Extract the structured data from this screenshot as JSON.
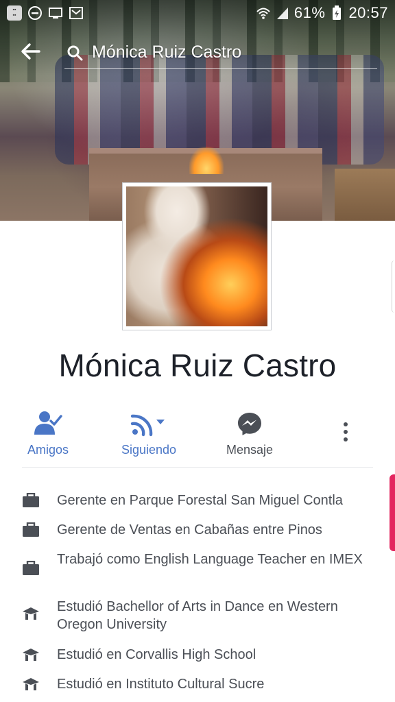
{
  "status_bar": {
    "battery": "61%",
    "time": "20:57"
  },
  "search": {
    "query": "Mónica Ruiz Castro"
  },
  "profile": {
    "name": "Mónica Ruiz Castro"
  },
  "actions": [
    {
      "label": "Amigos",
      "icon": "friends-check-icon"
    },
    {
      "label": "Siguiendo",
      "icon": "rss-follow-icon"
    },
    {
      "label": "Mensaje",
      "icon": "messenger-icon"
    }
  ],
  "info": [
    {
      "icon": "briefcase-icon",
      "text": "Gerente en Parque Forestal San Miguel Contla"
    },
    {
      "icon": "briefcase-icon",
      "text": "Gerente de Ventas en Cabañas entre Pinos"
    },
    {
      "icon": "briefcase-icon",
      "text": "Trabajó como English Language Teacher en IMEX"
    },
    {
      "icon": "graduation-cap-icon",
      "text": "Estudió Bachellor of Arts in Dance en Western Oregon University"
    },
    {
      "icon": "graduation-cap-icon",
      "text": "Estudió en Corvallis High School"
    },
    {
      "icon": "graduation-cap-icon",
      "text": "Estudió en Instituto Cultural Sucre"
    }
  ],
  "colors": {
    "accent_blue": "#4a76c6",
    "text_dark": "#1d2129",
    "text_gray": "#4b4f56",
    "edge_pink": "#e3255e"
  }
}
